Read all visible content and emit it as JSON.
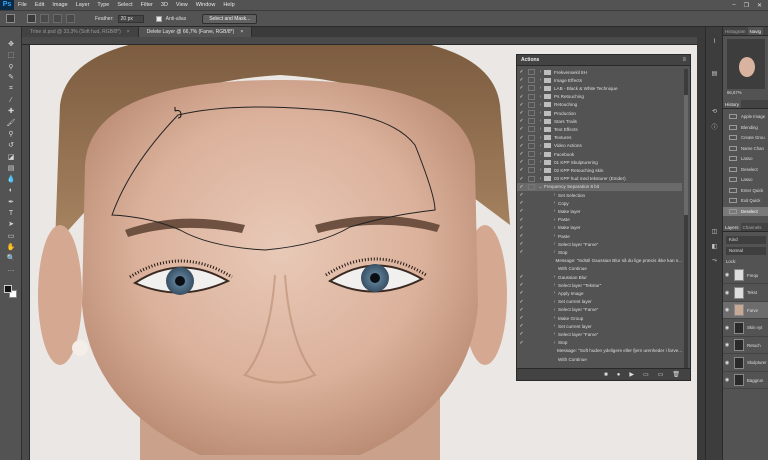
{
  "menubar": {
    "app_logo": "Ps",
    "items": [
      "File",
      "Edit",
      "Image",
      "Layer",
      "Type",
      "Select",
      "Filter",
      "3D",
      "View",
      "Window",
      "Help"
    ],
    "controls": [
      "–",
      "❐",
      "✕"
    ]
  },
  "options": {
    "feather_label": "Feather:",
    "feather_value": "20 px",
    "antialias_label": "Anti-alias",
    "select_mask_label": "Select and Mask..."
  },
  "tabs": [
    {
      "label": "Trine sl.psd @ 33,3% (Soft hud, RGB/8*)",
      "close": "×"
    },
    {
      "label": "Delete Layer @ 66,7% (Farve, RGB/8*)",
      "close": "×"
    }
  ],
  "actions": {
    "title": "Actions",
    "menu_icon": "≡",
    "rows": [
      {
        "label": "Frekvensekil 8H",
        "type": "set",
        "check": true
      },
      {
        "label": "Image Effects",
        "type": "set",
        "check": true
      },
      {
        "label": "LAB - Black & White Technique",
        "type": "set",
        "check": true
      },
      {
        "label": "Ps Retouching",
        "type": "set",
        "check": true
      },
      {
        "label": "Retouching",
        "type": "set",
        "check": true
      },
      {
        "label": "Production",
        "type": "set",
        "check": true
      },
      {
        "label": "Stars Trails",
        "type": "set",
        "check": true
      },
      {
        "label": "Text Effects",
        "type": "set",
        "check": true
      },
      {
        "label": "Textures",
        "type": "set",
        "check": true
      },
      {
        "label": "Video Actions",
        "type": "set",
        "check": true
      },
      {
        "label": "Facebook",
        "type": "set",
        "check": true
      },
      {
        "label": "01 KPP Skulpturering",
        "type": "set",
        "check": true
      },
      {
        "label": "02 KPP Retouching skin",
        "type": "set",
        "check": true
      },
      {
        "label": "03 KPP hud med teksturer (Emder)",
        "type": "set",
        "check": true
      },
      {
        "label": "Frequency Separation 8 bit",
        "type": "action",
        "check": true,
        "selected": true
      },
      {
        "label": "Set Selection",
        "type": "step",
        "check": true
      },
      {
        "label": "Copy",
        "type": "step",
        "check": true
      },
      {
        "label": "Make layer",
        "type": "step",
        "check": true
      },
      {
        "label": "Paste",
        "type": "step",
        "check": true
      },
      {
        "label": "Make layer",
        "type": "step",
        "check": true
      },
      {
        "label": "Paste",
        "type": "step",
        "check": true
      },
      {
        "label": "Select layer \"Farve\"",
        "type": "step",
        "check": true
      },
      {
        "label": "Stop",
        "type": "step",
        "check": true
      },
      {
        "label": "Message: \"Indstil Gaussian Blur så du lige præcis ikke kan s...",
        "type": "msg"
      },
      {
        "label": "With Continue",
        "type": "msg"
      },
      {
        "label": "Gaussian Blur",
        "type": "step",
        "check": true
      },
      {
        "label": "Select layer \"Tekstur\"",
        "type": "step",
        "check": true
      },
      {
        "label": "Apply Image",
        "type": "step",
        "check": true
      },
      {
        "label": "Set current layer",
        "type": "step",
        "check": true
      },
      {
        "label": "Select layer \"Farve\"",
        "type": "step",
        "check": true
      },
      {
        "label": "Make Group",
        "type": "step",
        "check": true
      },
      {
        "label": "Set current layer",
        "type": "step",
        "check": true
      },
      {
        "label": "Select layer \"Farve\"",
        "type": "step",
        "check": true
      },
      {
        "label": "Stop",
        "type": "step",
        "check": true
      },
      {
        "label": "Message: \"Soft huden ydeligere eller fjern urenheder i farve...",
        "type": "msg"
      },
      {
        "label": "With Continue",
        "type": "msg"
      }
    ],
    "footer_icons": [
      "■",
      "●",
      "▶",
      "▭",
      "▭",
      "🗑"
    ]
  },
  "right": {
    "top_tabs": [
      "Histogram",
      "Navig"
    ],
    "zoom_value": "66,67%",
    "history_tab": "History",
    "history_rows": [
      "Apple Image",
      "Blending",
      "Create Grou",
      "Name Chan",
      "Lasso",
      "Deselect",
      "Lasso",
      "Enter Quick",
      "Exit Quick",
      "Deselect"
    ],
    "layers_tabs": [
      "Layers",
      "Channels"
    ],
    "kind_label": "Kind",
    "blend_mode": "Normal",
    "lock_label": "Lock:",
    "layers": [
      {
        "name": "Frequ",
        "thumb": "folder"
      },
      {
        "name": "Tekst",
        "thumb": "white"
      },
      {
        "name": "Farve",
        "thumb": "face",
        "selected": true
      },
      {
        "name": "Skin nyt",
        "thumb": "dark"
      },
      {
        "name": "Retuch",
        "thumb": "dark"
      },
      {
        "name": "Skulpturer",
        "thumb": "dark"
      },
      {
        "name": "Baggrun",
        "thumb": "dark"
      }
    ]
  }
}
